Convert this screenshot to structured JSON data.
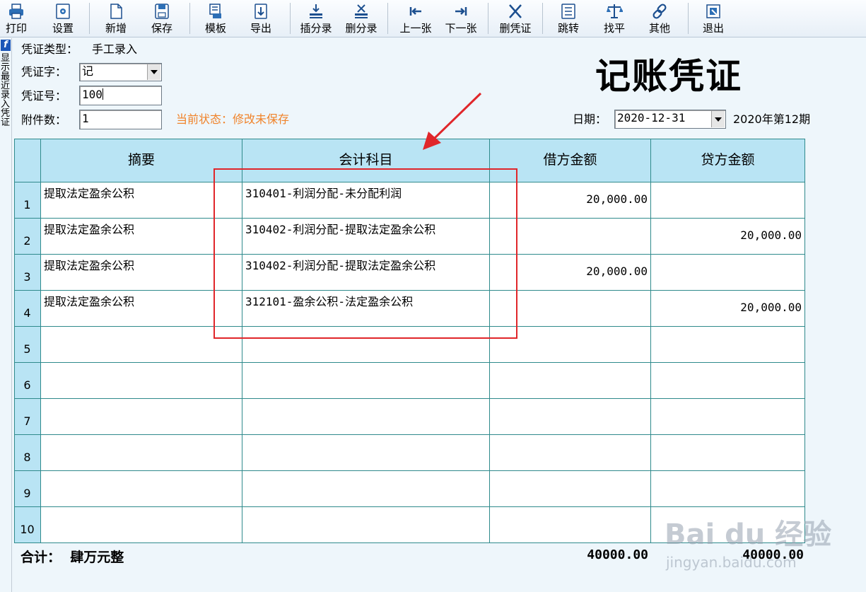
{
  "toolbar": {
    "items": [
      {
        "label": "打印",
        "icon": "printer-icon"
      },
      {
        "label": "设置",
        "icon": "settings-icon"
      },
      {
        "label": "新增",
        "icon": "new-document-icon"
      },
      {
        "label": "保存",
        "icon": "save-icon"
      },
      {
        "label": "模板",
        "icon": "template-icon"
      },
      {
        "label": "导出",
        "icon": "export-icon"
      },
      {
        "label": "插分录",
        "icon": "insert-entry-icon"
      },
      {
        "label": "删分录",
        "icon": "delete-entry-icon"
      },
      {
        "label": "上一张",
        "icon": "previous-icon"
      },
      {
        "label": "下一张",
        "icon": "next-icon"
      },
      {
        "label": "删凭证",
        "icon": "delete-voucher-icon"
      },
      {
        "label": "跳转",
        "icon": "jump-icon"
      },
      {
        "label": "找平",
        "icon": "balance-icon"
      },
      {
        "label": "其他",
        "icon": "link-icon"
      },
      {
        "label": "退出",
        "icon": "exit-icon"
      }
    ]
  },
  "side_panel": {
    "text": "显示最近录入凭证"
  },
  "voucher": {
    "type_label": "凭证类型：",
    "type_value": "手工录入",
    "word_label": "凭证字：",
    "word_value": "记",
    "number_label": "凭证号：",
    "number_value": "100",
    "attachments_label": "附件数：",
    "attachments_value": "1",
    "status": "当前状态：修改未保存",
    "title": "记账凭证",
    "date_label": "日期：",
    "date_value": "2020-12-31",
    "period": "2020年第12期"
  },
  "table": {
    "headers": [
      "摘要",
      "会计科目",
      "借方金额",
      "贷方金额"
    ],
    "rows": [
      {
        "no": "1",
        "summary": "提取法定盈余公积",
        "account": "310401-利润分配-未分配利润",
        "debit": "20,000.00",
        "credit": ""
      },
      {
        "no": "2",
        "summary": "提取法定盈余公积",
        "account": "310402-利润分配-提取法定盈余公积",
        "debit": "",
        "credit": "20,000.00"
      },
      {
        "no": "3",
        "summary": "提取法定盈余公积",
        "account": "310402-利润分配-提取法定盈余公积",
        "debit": "20,000.00",
        "credit": ""
      },
      {
        "no": "4",
        "summary": "提取法定盈余公积",
        "account": "312101-盈余公积-法定盈余公积",
        "debit": "",
        "credit": "20,000.00"
      },
      {
        "no": "5",
        "summary": "",
        "account": "",
        "debit": "",
        "credit": ""
      },
      {
        "no": "6",
        "summary": "",
        "account": "",
        "debit": "",
        "credit": ""
      },
      {
        "no": "7",
        "summary": "",
        "account": "",
        "debit": "",
        "credit": ""
      },
      {
        "no": "8",
        "summary": "",
        "account": "",
        "debit": "",
        "credit": ""
      },
      {
        "no": "9",
        "summary": "",
        "account": "",
        "debit": "",
        "credit": ""
      },
      {
        "no": "10",
        "summary": "",
        "account": "",
        "debit": "",
        "credit": ""
      }
    ]
  },
  "totals": {
    "label": "合计：",
    "in_words": "肆万元整",
    "debit_total": "40000.00",
    "credit_total": "40000.00"
  },
  "watermark": {
    "brand": "Bai du 经验",
    "url": "jingyan.baidu.com"
  },
  "colors": {
    "header_bg": "#b9e4f4",
    "grid_line": "#2f8a8c",
    "status_orange": "#f0832a",
    "highlight_red": "#e0262a"
  }
}
